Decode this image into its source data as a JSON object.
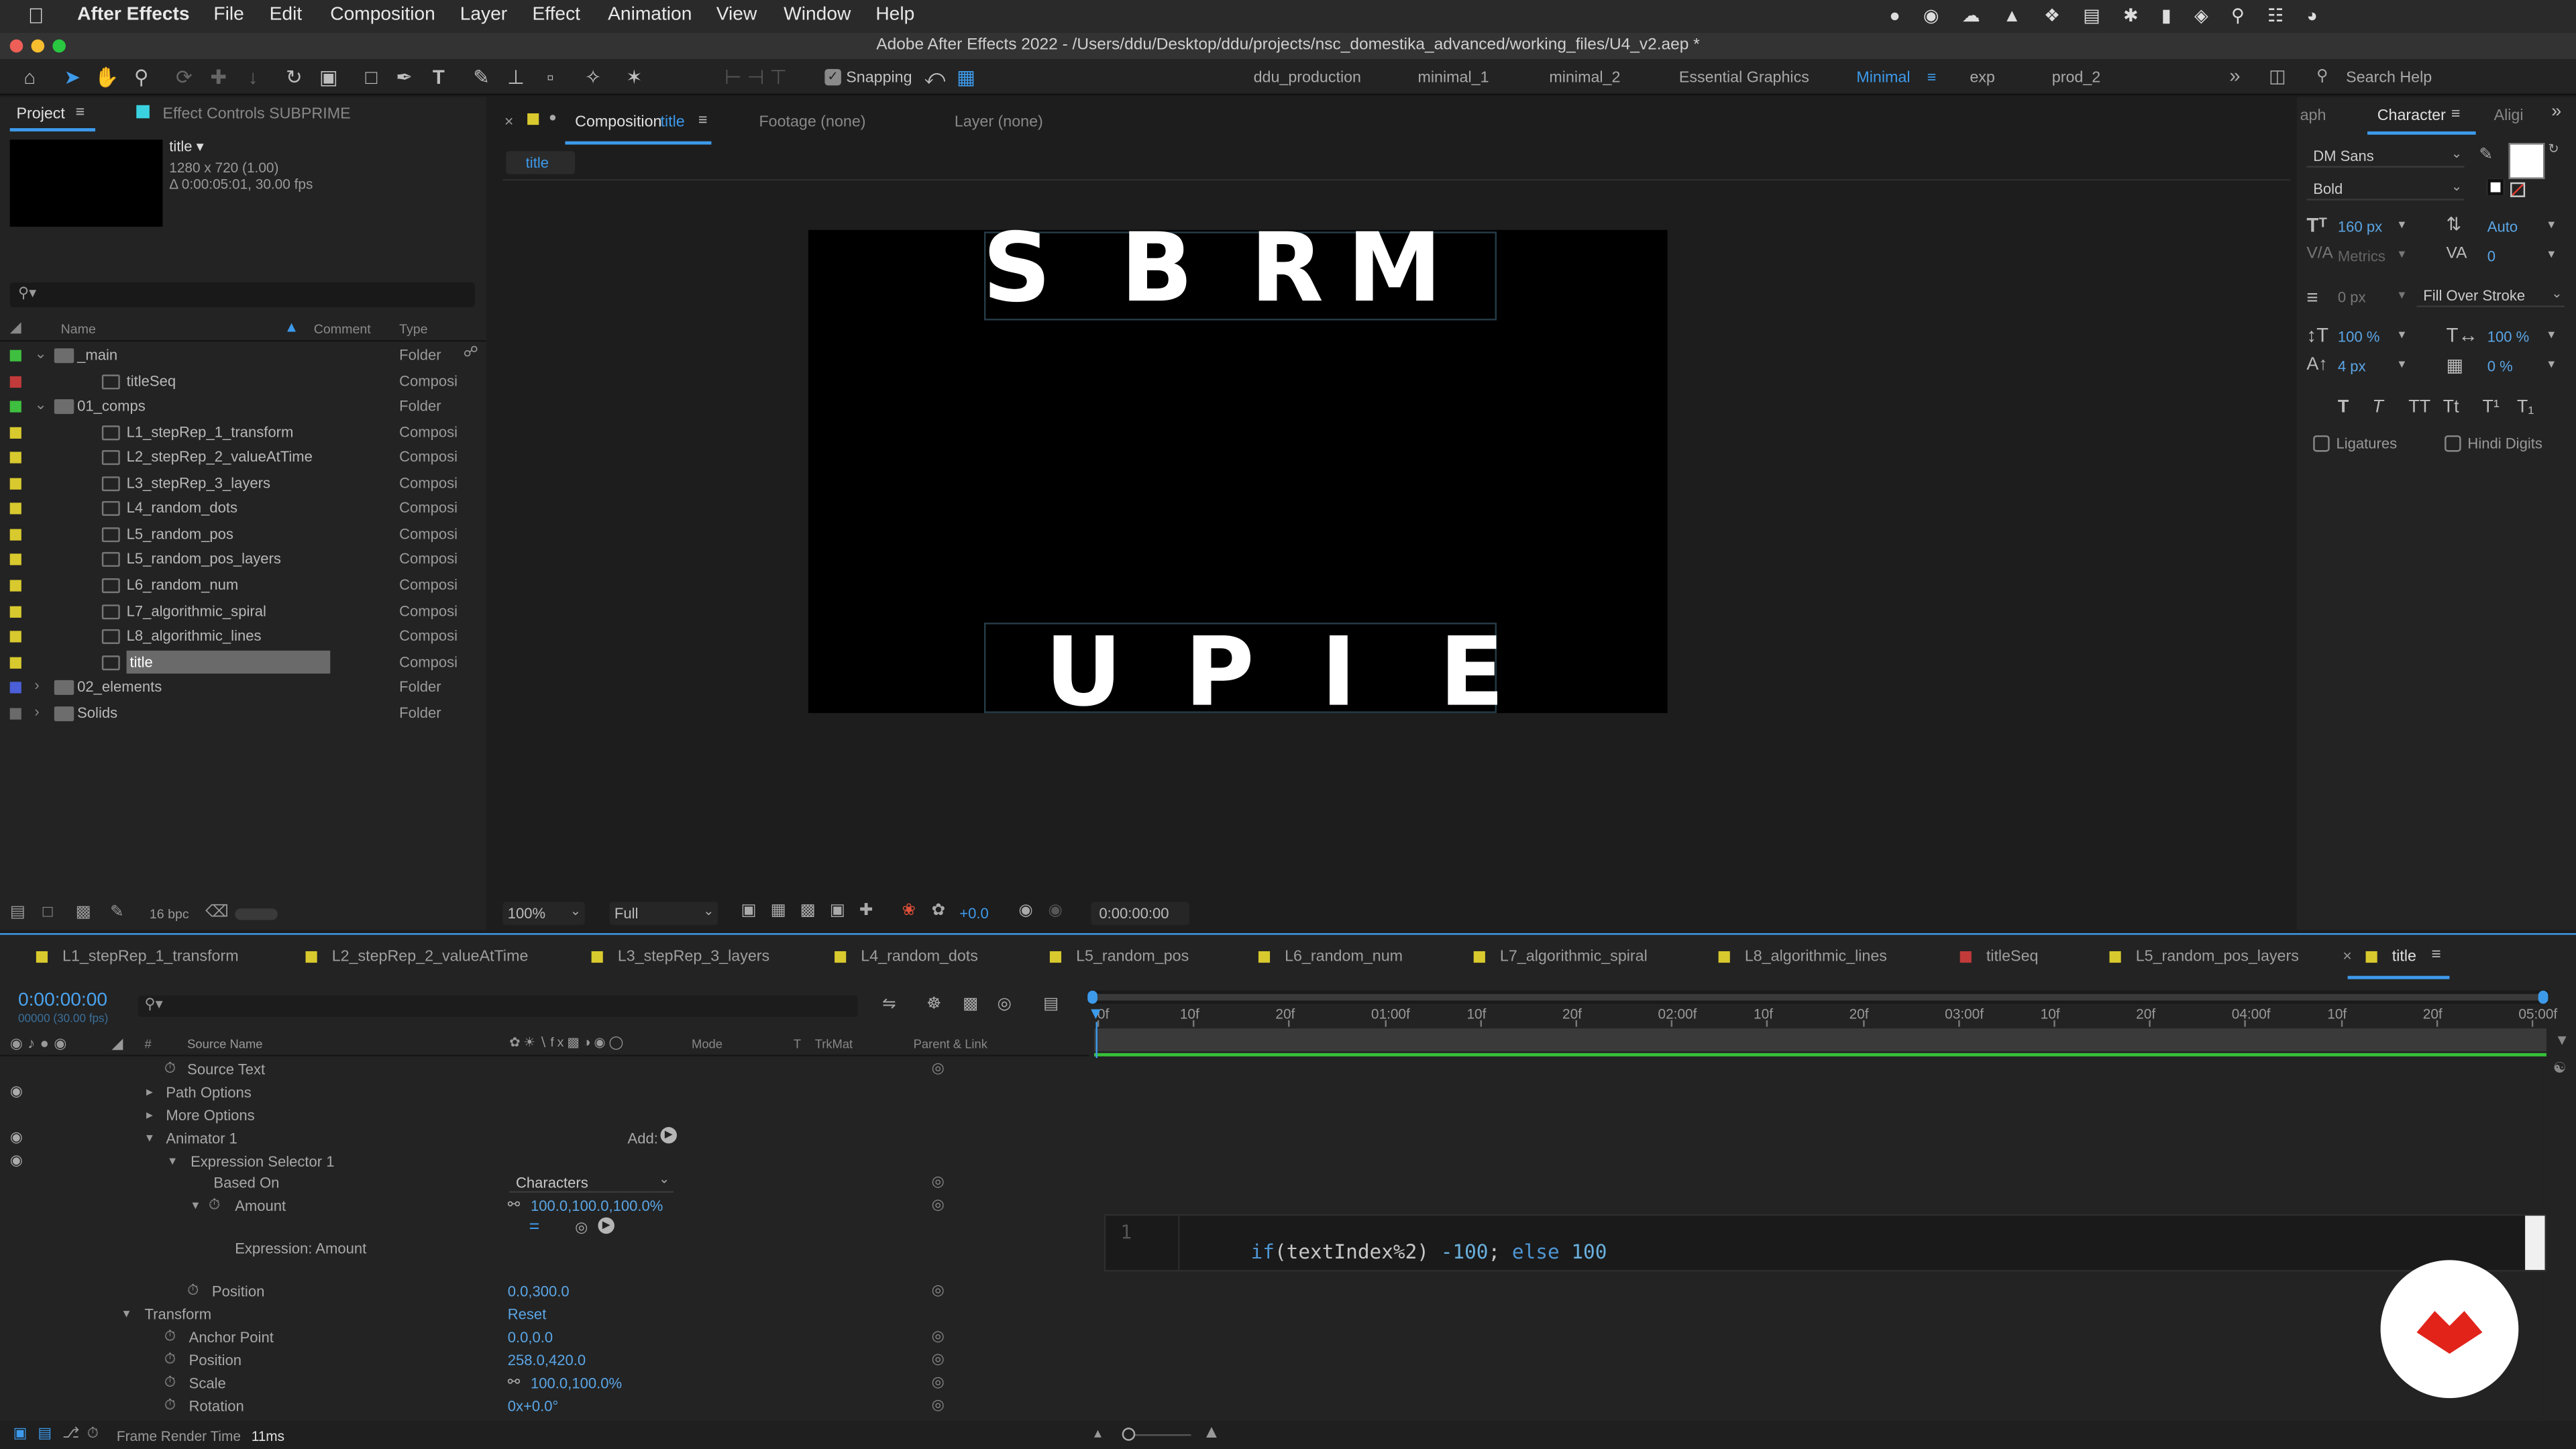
{
  "menubar": {
    "app": "After Effects",
    "items": [
      "File",
      "Edit",
      "Composition",
      "Layer",
      "Effect",
      "Animation",
      "View",
      "Window",
      "Help"
    ]
  },
  "window_title": "Adobe After Effects 2022 - /Users/ddu/Desktop/ddu/projects/nsc_domestika_advanced/working_files/U4_v2.aep *",
  "toolbar": {
    "snapping": "Snapping",
    "workspaces": [
      "ddu_production",
      "minimal_1",
      "minimal_2",
      "Essential Graphics",
      "Minimal",
      "exp",
      "prod_2"
    ],
    "active_workspace": "Minimal",
    "search_placeholder": "Search Help"
  },
  "project_panel": {
    "tab_project": "Project",
    "tab_effect_controls": "Effect Controls SUBPRIME",
    "selected_item": {
      "name": "title ▾",
      "dimensions": "1280 x 720 (1.00)",
      "duration": "Δ 0:00:05:01, 30.00 fps"
    },
    "search_placeholder": "",
    "columns": {
      "name": "Name",
      "comment": "Comment",
      "type": "Type"
    },
    "items": [
      {
        "name": "_main",
        "type": "Folder",
        "color": "#3fbf3f",
        "kind": "folder",
        "indent": 0,
        "twirl": "open"
      },
      {
        "name": "titleSeq",
        "type": "Composi",
        "color": "#c23a3a",
        "kind": "comp",
        "indent": 1
      },
      {
        "name": "01_comps",
        "type": "Folder",
        "color": "#3fbf3f",
        "kind": "folder",
        "indent": 0,
        "twirl": "open"
      },
      {
        "name": "L1_stepRep_1_transform",
        "type": "Composi",
        "color": "#d8c92e",
        "kind": "comp",
        "indent": 1
      },
      {
        "name": "L2_stepRep_2_valueAtTime",
        "type": "Composi",
        "color": "#d8c92e",
        "kind": "comp",
        "indent": 1
      },
      {
        "name": "L3_stepRep_3_layers",
        "type": "Composi",
        "color": "#d8c92e",
        "kind": "comp",
        "indent": 1
      },
      {
        "name": "L4_random_dots",
        "type": "Composi",
        "color": "#d8c92e",
        "kind": "comp",
        "indent": 1
      },
      {
        "name": "L5_random_pos",
        "type": "Composi",
        "color": "#d8c92e",
        "kind": "comp",
        "indent": 1
      },
      {
        "name": "L5_random_pos_layers",
        "type": "Composi",
        "color": "#d8c92e",
        "kind": "comp",
        "indent": 1
      },
      {
        "name": "L6_random_num",
        "type": "Composi",
        "color": "#d8c92e",
        "kind": "comp",
        "indent": 1
      },
      {
        "name": "L7_algorithmic_spiral",
        "type": "Composi",
        "color": "#d8c92e",
        "kind": "comp",
        "indent": 1
      },
      {
        "name": "L8_algorithmic_lines",
        "type": "Composi",
        "color": "#d8c92e",
        "kind": "comp",
        "indent": 1
      },
      {
        "name": "title",
        "type": "Composi",
        "color": "#d8c92e",
        "kind": "comp",
        "indent": 1,
        "selected": true
      },
      {
        "name": "02_elements",
        "type": "Folder",
        "color": "#4a5fd8",
        "kind": "folder",
        "indent": 0,
        "twirl": "closed"
      },
      {
        "name": "Solids",
        "type": "Folder",
        "color": "#6a6a6a",
        "kind": "folder",
        "indent": 0,
        "twirl": "closed"
      }
    ],
    "bit_depth": "16 bpc"
  },
  "composition_panel": {
    "tab_composition": "Composition",
    "tab_composition_name": "title",
    "tab_footage": "Footage (none)",
    "tab_layer": "Layer (none)",
    "breadcrumb": "title",
    "viewer_text_top": [
      "S",
      "B",
      "R",
      "M"
    ],
    "viewer_text_bottom": [
      "U",
      "P",
      "I",
      "E"
    ],
    "zoom": "100%",
    "resolution": "Full",
    "exposure": "+0.0",
    "timecode": "0:00:00:00"
  },
  "character_panel": {
    "tabs": [
      "aph",
      "Character",
      "Aligi"
    ],
    "font": "DM Sans",
    "style": "Bold",
    "font_size": "160 px",
    "leading": "Auto",
    "kerning": "Metrics",
    "tracking": "0",
    "stroke_width": "0 px",
    "stroke_mode": "Fill Over Stroke",
    "vertical_scale": "100 %",
    "horizontal_scale": "100 %",
    "baseline_shift": "4 px",
    "tsume": "0 %",
    "style_buttons": [
      "T",
      "T",
      "TT",
      "Tt",
      "T¹",
      "T₁"
    ],
    "ligatures": "Ligatures",
    "hindi_digits": "Hindi Digits"
  },
  "timeline": {
    "comp_tabs": [
      {
        "label": "L1_stepRep_1_transform",
        "color": "#d8c92e"
      },
      {
        "label": "L2_stepRep_2_valueAtTime",
        "color": "#d8c92e"
      },
      {
        "label": "L3_stepRep_3_layers",
        "color": "#d8c92e"
      },
      {
        "label": "L4_random_dots",
        "color": "#d8c92e"
      },
      {
        "label": "L5_random_pos",
        "color": "#d8c92e"
      },
      {
        "label": "L6_random_num",
        "color": "#d8c92e"
      },
      {
        "label": "L7_algorithmic_spiral",
        "color": "#d8c92e"
      },
      {
        "label": "L8_algorithmic_lines",
        "color": "#d8c92e"
      },
      {
        "label": "titleSeq",
        "color": "#c23a3a"
      },
      {
        "label": "L5_random_pos_layers",
        "color": "#d8c92e"
      },
      {
        "label": "title",
        "color": "#d8c92e",
        "active": true
      }
    ],
    "current_time": "0:00:00:00",
    "frame_info": "00000 (30.00 fps)",
    "columns": {
      "source_name": "Source Name",
      "mode": "Mode",
      "t": "T",
      "trkmat": "TrkMat",
      "parent": "Parent & Link",
      "hash": "#"
    },
    "ruler_ticks": [
      "0f",
      "10f",
      "20f",
      "01:00f",
      "10f",
      "20f",
      "02:00f",
      "10f",
      "20f",
      "03:00f",
      "10f",
      "20f",
      "04:00f",
      "10f",
      "20f",
      "05:00f"
    ],
    "properties": {
      "source_text": "Source Text",
      "path_options": "Path Options",
      "more_options": "More Options",
      "animator": "Animator 1",
      "add_label": "Add:",
      "expression_selector": "Expression Selector 1",
      "based_on_label": "Based On",
      "based_on_value": "Characters",
      "amount_label": "Amount",
      "amount_value": "100.0,100.0,100.0%",
      "expression_label": "Expression: Amount",
      "position_label": "Position",
      "position_value": "0.0,300.0",
      "transform_label": "Transform",
      "transform_reset": "Reset",
      "anchor_label": "Anchor Point",
      "anchor_value": "0.0,0.0",
      "t_position_label": "Position",
      "t_position_value": "258.0,420.0",
      "scale_label": "Scale",
      "scale_value": "100.0,100.0%",
      "rotation_label": "Rotation",
      "rotation_value": "0x+0.0°"
    },
    "expression": {
      "line_number": "1",
      "code_kw1": "if",
      "code_mid1": "(textIndex%2) ",
      "code_num1": "-100",
      "code_mid2": "; ",
      "code_kw2": "else",
      "code_num2": " 100"
    },
    "footer": {
      "render_label": "Frame Render Time",
      "render_value": "11ms"
    }
  }
}
